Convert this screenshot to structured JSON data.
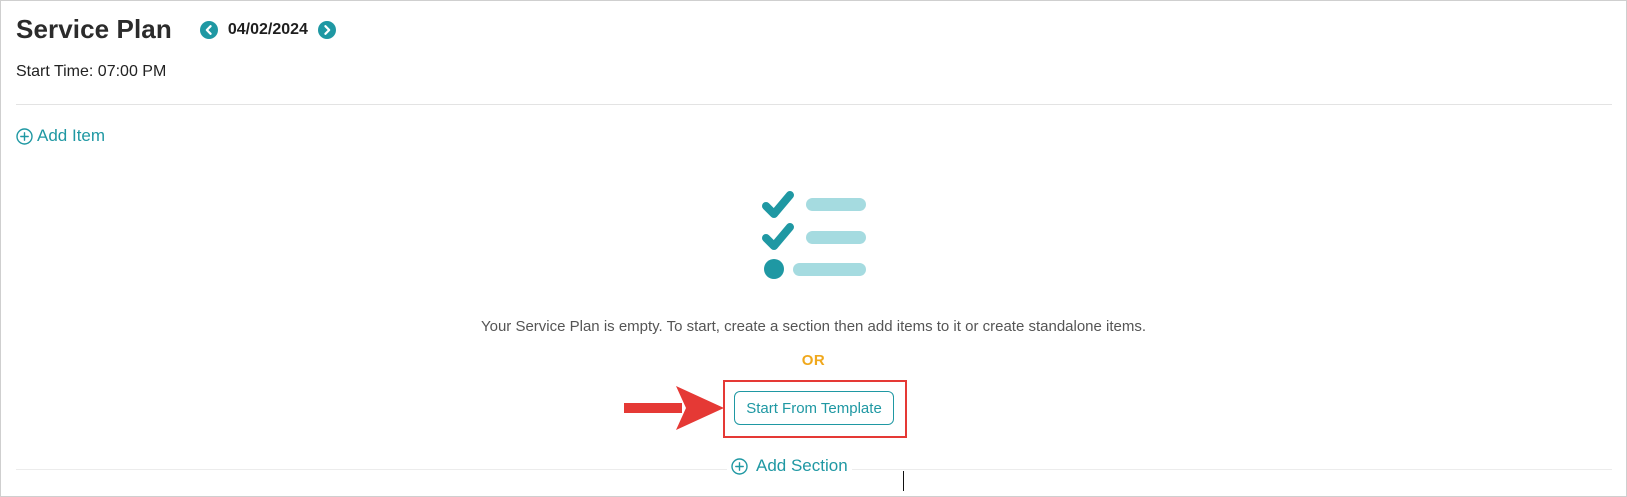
{
  "header": {
    "title": "Service Plan",
    "date": "04/02/2024",
    "prev_icon": "chevron-left-icon",
    "next_icon": "chevron-right-icon"
  },
  "start_time": "Start Time: 07:00 PM",
  "add_item": {
    "label": "Add Item",
    "icon": "plus-circle-icon"
  },
  "empty_state": {
    "illustration": "checklist-icon",
    "message": "Your Service Plan is empty. To start, create a section then add items to it or create standalone items.",
    "or_label": "OR",
    "template_button": "Start From Template"
  },
  "add_section": {
    "label": "Add Section",
    "icon": "plus-circle-icon"
  },
  "annotation": {
    "arrow": "red-arrow",
    "highlight": "red-highlight-box"
  },
  "colors": {
    "accent": "#1f98a3",
    "accent_light": "#a5dbe0",
    "or_color": "#f0a81c",
    "annotation": "#e53935"
  }
}
